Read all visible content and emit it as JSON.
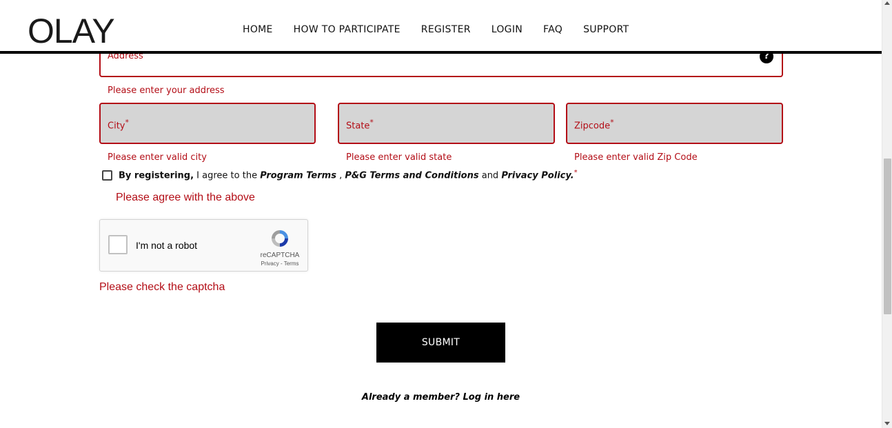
{
  "header": {
    "logo": "OLAY",
    "nav": [
      "HOME",
      "HOW TO PARTICIPATE",
      "REGISTER",
      "LOGIN",
      "FAQ",
      "SUPPORT"
    ]
  },
  "form": {
    "address": {
      "label": "Address",
      "help": "?",
      "error": "Please enter your address"
    },
    "city": {
      "label": "City",
      "required": "*",
      "error": "Please enter valid city"
    },
    "state": {
      "label": "State",
      "required": "*",
      "error": "Please enter valid state"
    },
    "zip": {
      "label": "Zipcode",
      "required": "*",
      "error": "Please enter valid Zip Code"
    },
    "agreement": {
      "lead": "By registering,",
      "text1": " I agree to the ",
      "program_terms": "Program Terms",
      "sep": " , ",
      "pg_terms": "P&G Terms and Conditions",
      "and": " and ",
      "privacy": "Privacy Policy.",
      "required": "*",
      "error": "Please agree with the above"
    },
    "captcha": {
      "label": "I'm not a robot",
      "brand": "reCAPTCHA",
      "links": "Privacy - Terms",
      "error": "Please check the captcha"
    },
    "submit_label": "SUBMIT",
    "login_prompt": "Already a member? Log in here"
  }
}
